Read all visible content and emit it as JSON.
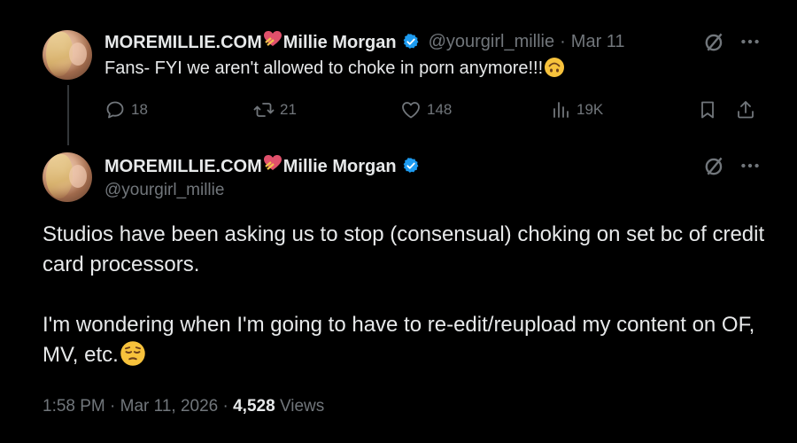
{
  "reply_to": {
    "display_name": "MOREMILLIE.COM",
    "display_name_suffix": "Millie Morgan",
    "handle": "@yourgirl_millie",
    "separator": "·",
    "date": "Mar 11",
    "text": "Fans- FYI we aren't allowed to choke in porn anymore!!!",
    "emoji": "upside-down-face",
    "actions": {
      "replies": "18",
      "reposts": "21",
      "likes": "148",
      "views": "19K"
    }
  },
  "main_tweet": {
    "display_name": "MOREMILLIE.COM",
    "display_name_suffix": "Millie Morgan",
    "handle": "@yourgirl_millie",
    "paragraph1": "Studios have been asking us to stop (consensual) choking on set bc of credit card processors.",
    "paragraph2": "I'm wondering when I'm going to have to re-edit/reupload my content on OF, MV, etc.",
    "emoji": "pensive-face",
    "time": "1:58 PM",
    "separator": "·",
    "date": "Mar 11, 2026",
    "separator2": "·",
    "views_count": "4,528",
    "views_label": "Views"
  },
  "colors": {
    "background": "#000000",
    "text": "#e7e9ea",
    "muted": "#71767b",
    "verified": "#1d9bf0"
  },
  "icons": [
    "heart-with-ribbon-icon",
    "verified-badge-icon",
    "grok-icon",
    "more-icon",
    "reply-icon",
    "repost-icon",
    "like-icon",
    "views-icon",
    "bookmark-icon",
    "share-icon"
  ]
}
